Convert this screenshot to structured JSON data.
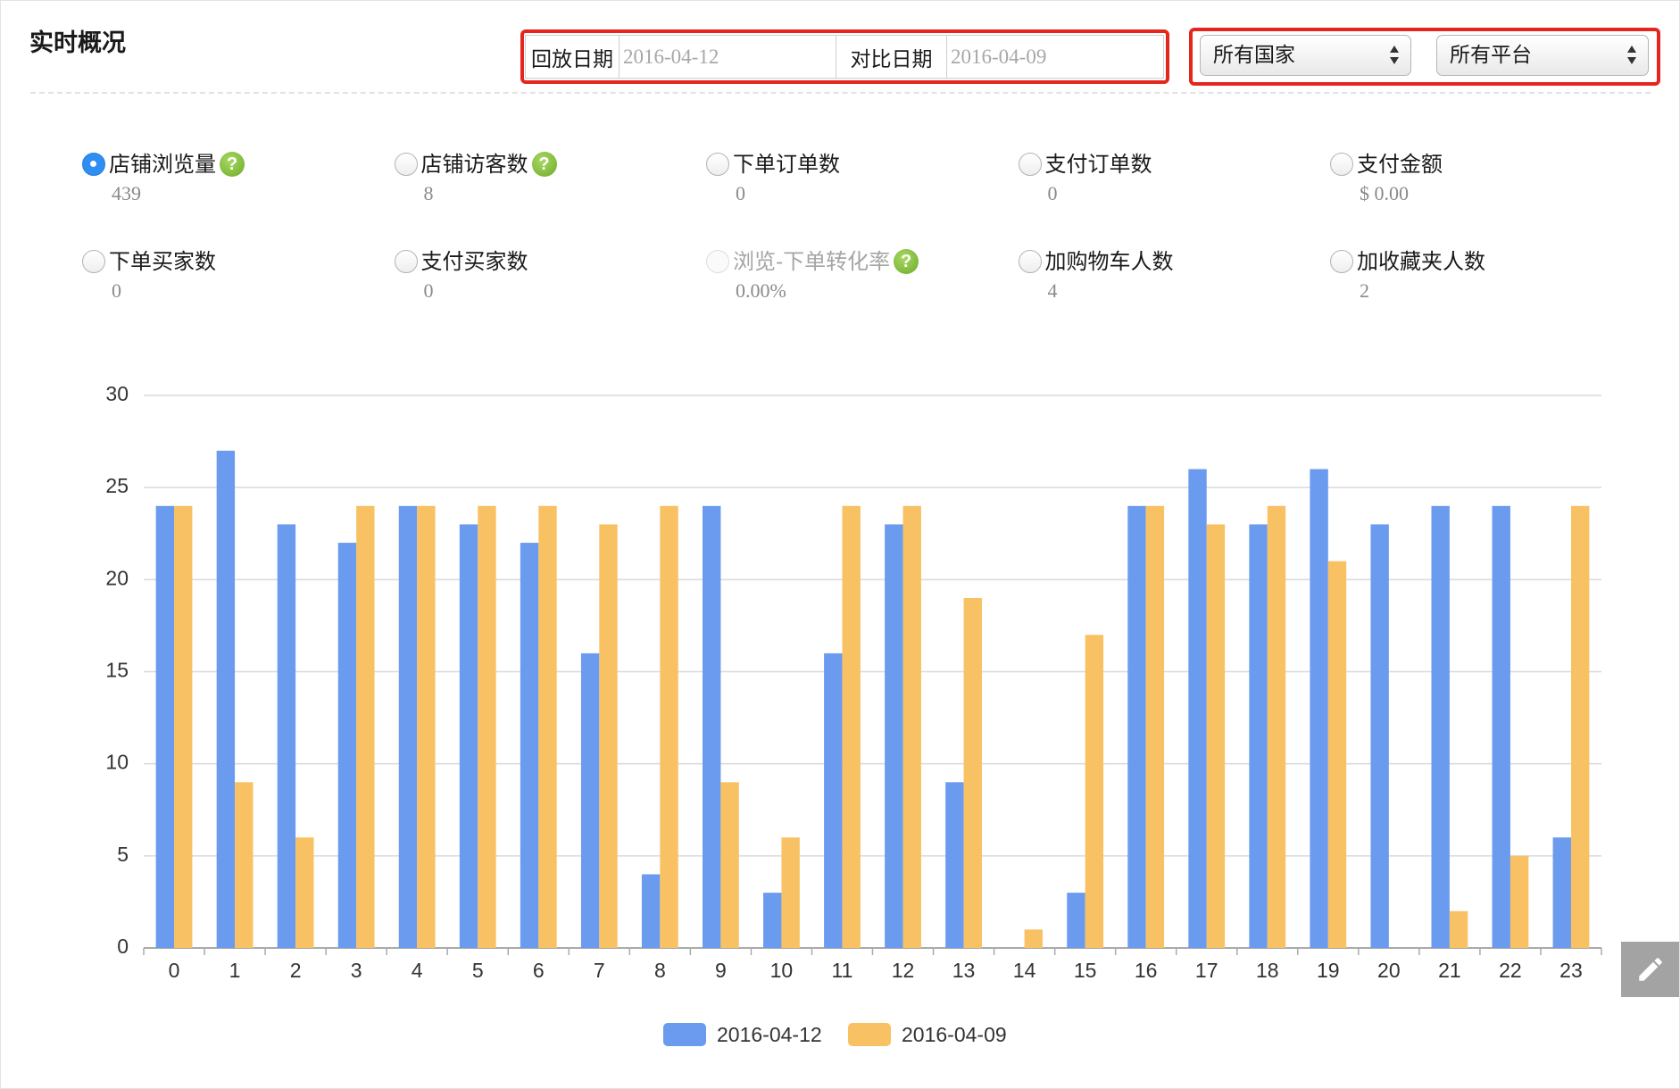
{
  "header": {
    "title": "实时概况",
    "replay_date_label": "回放日期",
    "replay_date_value": "2016-04-12",
    "compare_date_label": "对比日期",
    "compare_date_value": "2016-04-09",
    "country_select": "所有国家",
    "platform_select": "所有平台"
  },
  "metrics": [
    {
      "label": "店铺浏览量",
      "value": "439",
      "checked": true,
      "help": true,
      "disabled": false
    },
    {
      "label": "店铺访客数",
      "value": "8",
      "checked": false,
      "help": true,
      "disabled": false
    },
    {
      "label": "下单订单数",
      "value": "0",
      "checked": false,
      "help": false,
      "disabled": false
    },
    {
      "label": "支付订单数",
      "value": "0",
      "checked": false,
      "help": false,
      "disabled": false
    },
    {
      "label": "支付金额",
      "value": "$ 0.00",
      "checked": false,
      "help": false,
      "disabled": false
    },
    {
      "label": "下单买家数",
      "value": "0",
      "checked": false,
      "help": false,
      "disabled": false
    },
    {
      "label": "支付买家数",
      "value": "0",
      "checked": false,
      "help": false,
      "disabled": false
    },
    {
      "label": "浏览-下单转化率",
      "value": "0.00%",
      "checked": false,
      "help": true,
      "disabled": true
    },
    {
      "label": "加购物车人数",
      "value": "4",
      "checked": false,
      "help": false,
      "disabled": false
    },
    {
      "label": "加收藏夹人数",
      "value": "2",
      "checked": false,
      "help": false,
      "disabled": false
    }
  ],
  "icons": {
    "help": "help-icon",
    "help_glyph": "?",
    "select_arrows": "up-down-arrows-icon",
    "edit": "pencil-icon"
  },
  "colors": {
    "highlight_frame": "#e5261c",
    "radio_checked": "#2e8ef2",
    "help_green": "#7cbd35"
  },
  "chart_data": {
    "type": "bar",
    "title": "",
    "xlabel": "",
    "ylabel": "",
    "categories": [
      "0",
      "1",
      "2",
      "3",
      "4",
      "5",
      "6",
      "7",
      "8",
      "9",
      "10",
      "11",
      "12",
      "13",
      "14",
      "15",
      "16",
      "17",
      "18",
      "19",
      "20",
      "21",
      "22",
      "23"
    ],
    "series": [
      {
        "name": "2016-04-12",
        "color": "#6b9bef",
        "values": [
          24,
          27,
          23,
          22,
          24,
          23,
          22,
          16,
          4,
          24,
          3,
          16,
          23,
          9,
          0,
          3,
          24,
          26,
          23,
          26,
          23,
          24,
          24,
          6
        ]
      },
      {
        "name": "2016-04-09",
        "color": "#f8c264",
        "values": [
          24,
          9,
          6,
          24,
          24,
          24,
          24,
          23,
          24,
          9,
          6,
          24,
          24,
          19,
          1,
          17,
          24,
          23,
          24,
          21,
          0,
          2,
          5,
          24
        ]
      }
    ],
    "ylim": [
      0,
      30
    ],
    "yticks": [
      0,
      5,
      10,
      15,
      20,
      25,
      30
    ],
    "grid": true,
    "legend": "bottom-center"
  }
}
